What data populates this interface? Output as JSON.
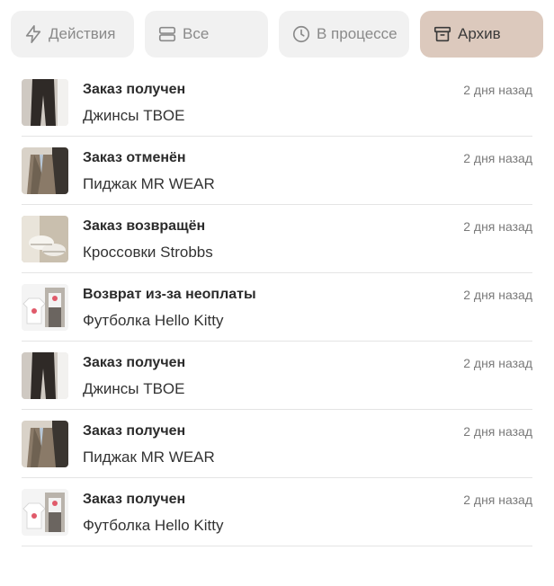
{
  "filters": [
    {
      "label": "Действия",
      "icon": "lightning-icon",
      "active": false
    },
    {
      "label": "Все",
      "icon": "list-icon",
      "active": false
    },
    {
      "label": "В процессе",
      "icon": "clock-icon",
      "active": false
    },
    {
      "label": "Архив",
      "icon": "archive-icon",
      "active": true
    }
  ],
  "colors": {
    "chip_bg": "#f1f1f1",
    "chip_active_bg": "#dcc9bd",
    "divider": "#e4e4e4"
  },
  "orders": [
    {
      "title": "Заказ получен",
      "item": "Джинсы TBOE",
      "time": "2 дня назад",
      "image": "jeans-photo"
    },
    {
      "title": "Заказ отменён",
      "item": "Пиджак MR WEAR",
      "time": "2 дня назад",
      "image": "blazer-photo"
    },
    {
      "title": "Заказ возвращён",
      "item": "Кроссовки Strobbs",
      "time": "2 дня назад",
      "image": "sneakers-photo"
    },
    {
      "title": "Возврат из-за неоплаты",
      "item": "Футболка Hello Kitty",
      "time": "2 дня назад",
      "image": "tshirt-photo"
    },
    {
      "title": "Заказ получен",
      "item": "Джинсы TBOE",
      "time": "2 дня назад",
      "image": "jeans-photo"
    },
    {
      "title": "Заказ получен",
      "item": "Пиджак MR WEAR",
      "time": "2 дня назад",
      "image": "blazer-photo"
    },
    {
      "title": "Заказ получен",
      "item": "Футболка Hello Kitty",
      "time": "2 дня назад",
      "image": "tshirt-photo"
    }
  ]
}
